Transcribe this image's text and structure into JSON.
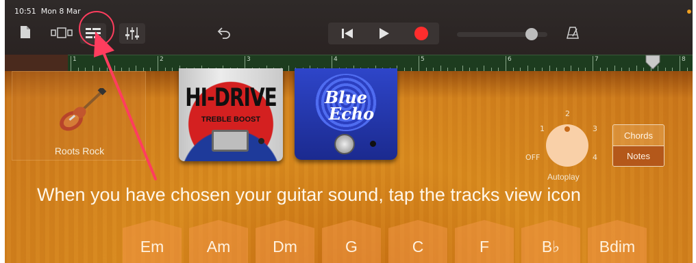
{
  "status": {
    "time": "10:51",
    "date": "Mon 8 Mar"
  },
  "toolbar": {
    "icons": [
      "document-icon",
      "view-toggle-icon",
      "tracks-view-icon",
      "mixer-icon",
      "undo-icon",
      "rewind-icon",
      "play-icon",
      "record-icon",
      "volume-slider",
      "metronome-icon"
    ],
    "volume_level": 0.85
  },
  "ruler": {
    "bars": [
      "1",
      "2",
      "3",
      "4",
      "5",
      "6",
      "7",
      "8"
    ]
  },
  "preset": {
    "label": "Roots Rock"
  },
  "pedals": [
    {
      "name": "HI-DRIVE",
      "subtitle": "TREBLE BOOST"
    },
    {
      "name_line1": "Blue",
      "name_line2": "Echo"
    }
  ],
  "autoplay": {
    "label": "Autoplay",
    "positions": [
      "OFF",
      "1",
      "2",
      "3",
      "4"
    ]
  },
  "mode_toggle": {
    "chords": "Chords",
    "notes": "Notes",
    "selected": "Notes"
  },
  "caption": "When you have chosen your guitar sound, tap the tracks view icon",
  "chords": [
    "Em",
    "Am",
    "Dm",
    "G",
    "C",
    "F",
    "B♭",
    "Bdim"
  ],
  "colors": {
    "annotation": "#ff3d5e",
    "record": "#ff2d2d",
    "accent_orange": "#f0a020"
  }
}
